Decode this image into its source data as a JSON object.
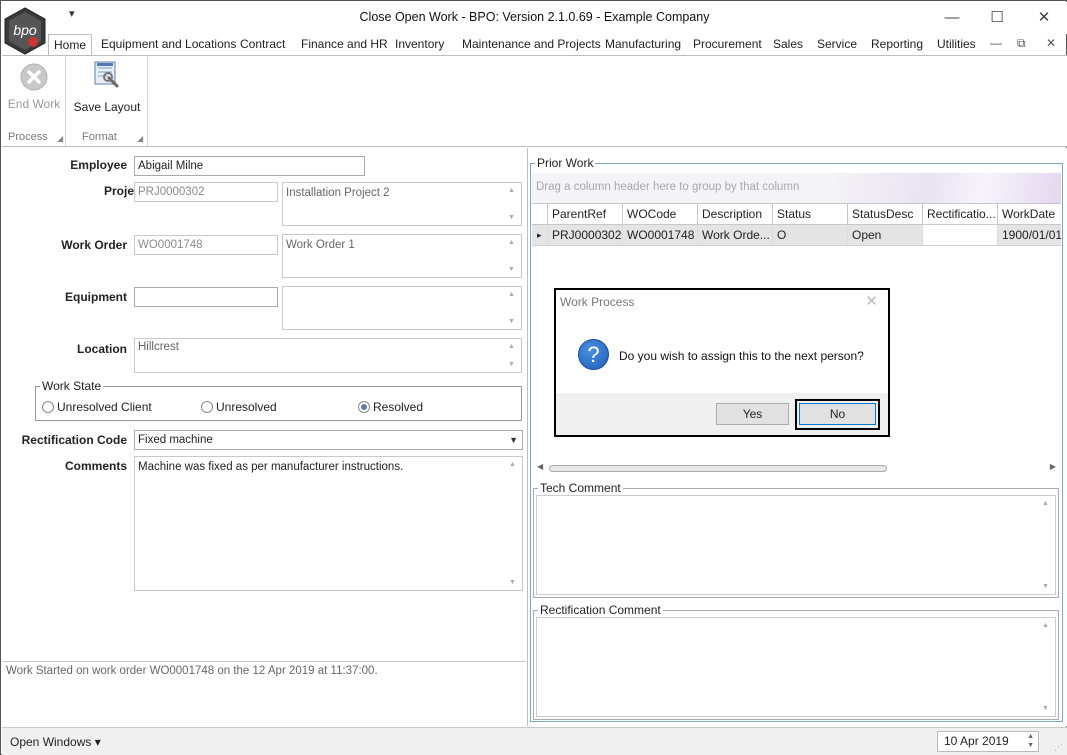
{
  "window": {
    "title": "Close Open Work - BPO: Version 2.1.0.69 - Example Company",
    "logo_text": "bpo",
    "quick_access": "▾",
    "controls": {
      "minimize": "—",
      "maximize": "☐",
      "close": "✕"
    },
    "mdi_controls": {
      "minimize": "—",
      "restore": "⧉",
      "close": "✕"
    }
  },
  "menu_tabs": [
    "Home",
    "Equipment and Locations",
    "Contract",
    "Finance and HR",
    "Inventory",
    "Maintenance and Projects",
    "Manufacturing",
    "Procurement",
    "Sales",
    "Service",
    "Reporting",
    "Utilities"
  ],
  "ribbon": {
    "groups": [
      {
        "name": "Process",
        "buttons": [
          {
            "label": "End Work",
            "icon": "cancel-x-icon",
            "enabled": false
          }
        ]
      },
      {
        "name": "Format",
        "buttons": [
          {
            "label": "Save Layout",
            "icon": "save-layout-icon",
            "enabled": true
          }
        ]
      }
    ],
    "launcher": "◢"
  },
  "form": {
    "employee": {
      "label": "Employee",
      "value": "Abigail Milne"
    },
    "project": {
      "label": "Proje",
      "code": "PRJ0000302",
      "description": "Installation Project 2"
    },
    "work_order": {
      "label": "Work Order",
      "code": "WO0001748",
      "description": "Work Order 1"
    },
    "equipment": {
      "label": "Equipment",
      "code": "",
      "description": ""
    },
    "location": {
      "label": "Location",
      "value": "Hillcrest"
    },
    "work_state": {
      "legend": "Work State",
      "options": [
        {
          "label": "Unresolved Client",
          "selected": false
        },
        {
          "label": "Unresolved",
          "selected": false
        },
        {
          "label": "Resolved",
          "selected": true
        }
      ]
    },
    "rectification_code": {
      "label": "Rectification Code",
      "value": "Fixed machine"
    },
    "comments": {
      "label": "Comments",
      "value": "Machine was fixed as per manufacturer instructions."
    }
  },
  "log_message": "Work Started on work order WO0001748 on the 12 Apr 2019 at 11:37:00.",
  "prior_work": {
    "title": "Prior Work",
    "group_hint": "Drag a column header here to group by that column",
    "columns": [
      "ParentRef",
      "WOCode",
      "Description",
      "Status",
      "StatusDesc",
      "Rectificatio...",
      "WorkDate"
    ],
    "rows": [
      [
        "PRJ0000302",
        "WO0001748",
        "Work Orde...",
        "O",
        "Open",
        "",
        "1900/01/01"
      ]
    ],
    "row_indicator": "▸"
  },
  "tech_comment": {
    "title": "Tech Comment"
  },
  "rectification_comment": {
    "title": "Rectification Comment"
  },
  "statusbar": {
    "open_windows": "Open Windows ▾",
    "date": "10 Apr 2019"
  },
  "dialog": {
    "title": "Work Process",
    "close": "✕",
    "icon": "question-icon",
    "icon_glyph": "?",
    "message": "Do you wish to assign this to the next person?",
    "yes_label": "Yes",
    "no_label": "No"
  },
  "colors": {
    "accent": "#1d5fb8",
    "grid_selected_row": "#e4e4e4",
    "ribbon_border": "#bdbdbd"
  }
}
